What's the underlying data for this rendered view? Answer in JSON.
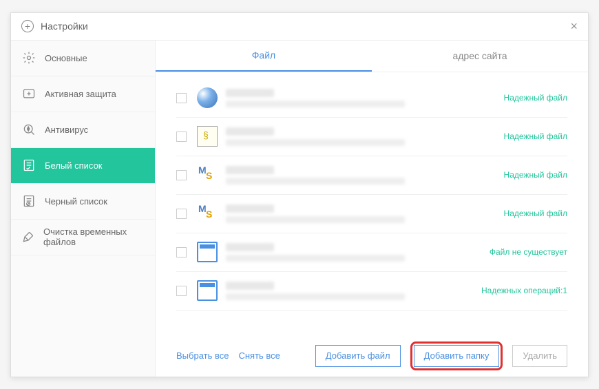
{
  "window": {
    "title": "Настройки"
  },
  "sidebar": {
    "items": [
      {
        "label": "Основные"
      },
      {
        "label": "Активная защита"
      },
      {
        "label": "Антивирус"
      },
      {
        "label": "Белый список"
      },
      {
        "label": "Черный список"
      },
      {
        "label": "Очистка временных файлов"
      }
    ]
  },
  "tabs": {
    "file": "Файл",
    "site": "адрес сайта"
  },
  "rows": [
    {
      "status": "Надежный файл",
      "icon": "win"
    },
    {
      "status": "Надежный файл",
      "icon": "doc"
    },
    {
      "status": "Надежный файл",
      "icon": "ms"
    },
    {
      "status": "Надежный файл",
      "icon": "ms"
    },
    {
      "status": "Файл не существует",
      "icon": "folder"
    },
    {
      "status": "Надежных операций:1",
      "icon": "folder"
    }
  ],
  "footer": {
    "select_all": "Выбрать все",
    "deselect_all": "Снять все",
    "add_file": "Добавить файл",
    "add_folder": "Добавить папку",
    "delete": "Удалить"
  }
}
